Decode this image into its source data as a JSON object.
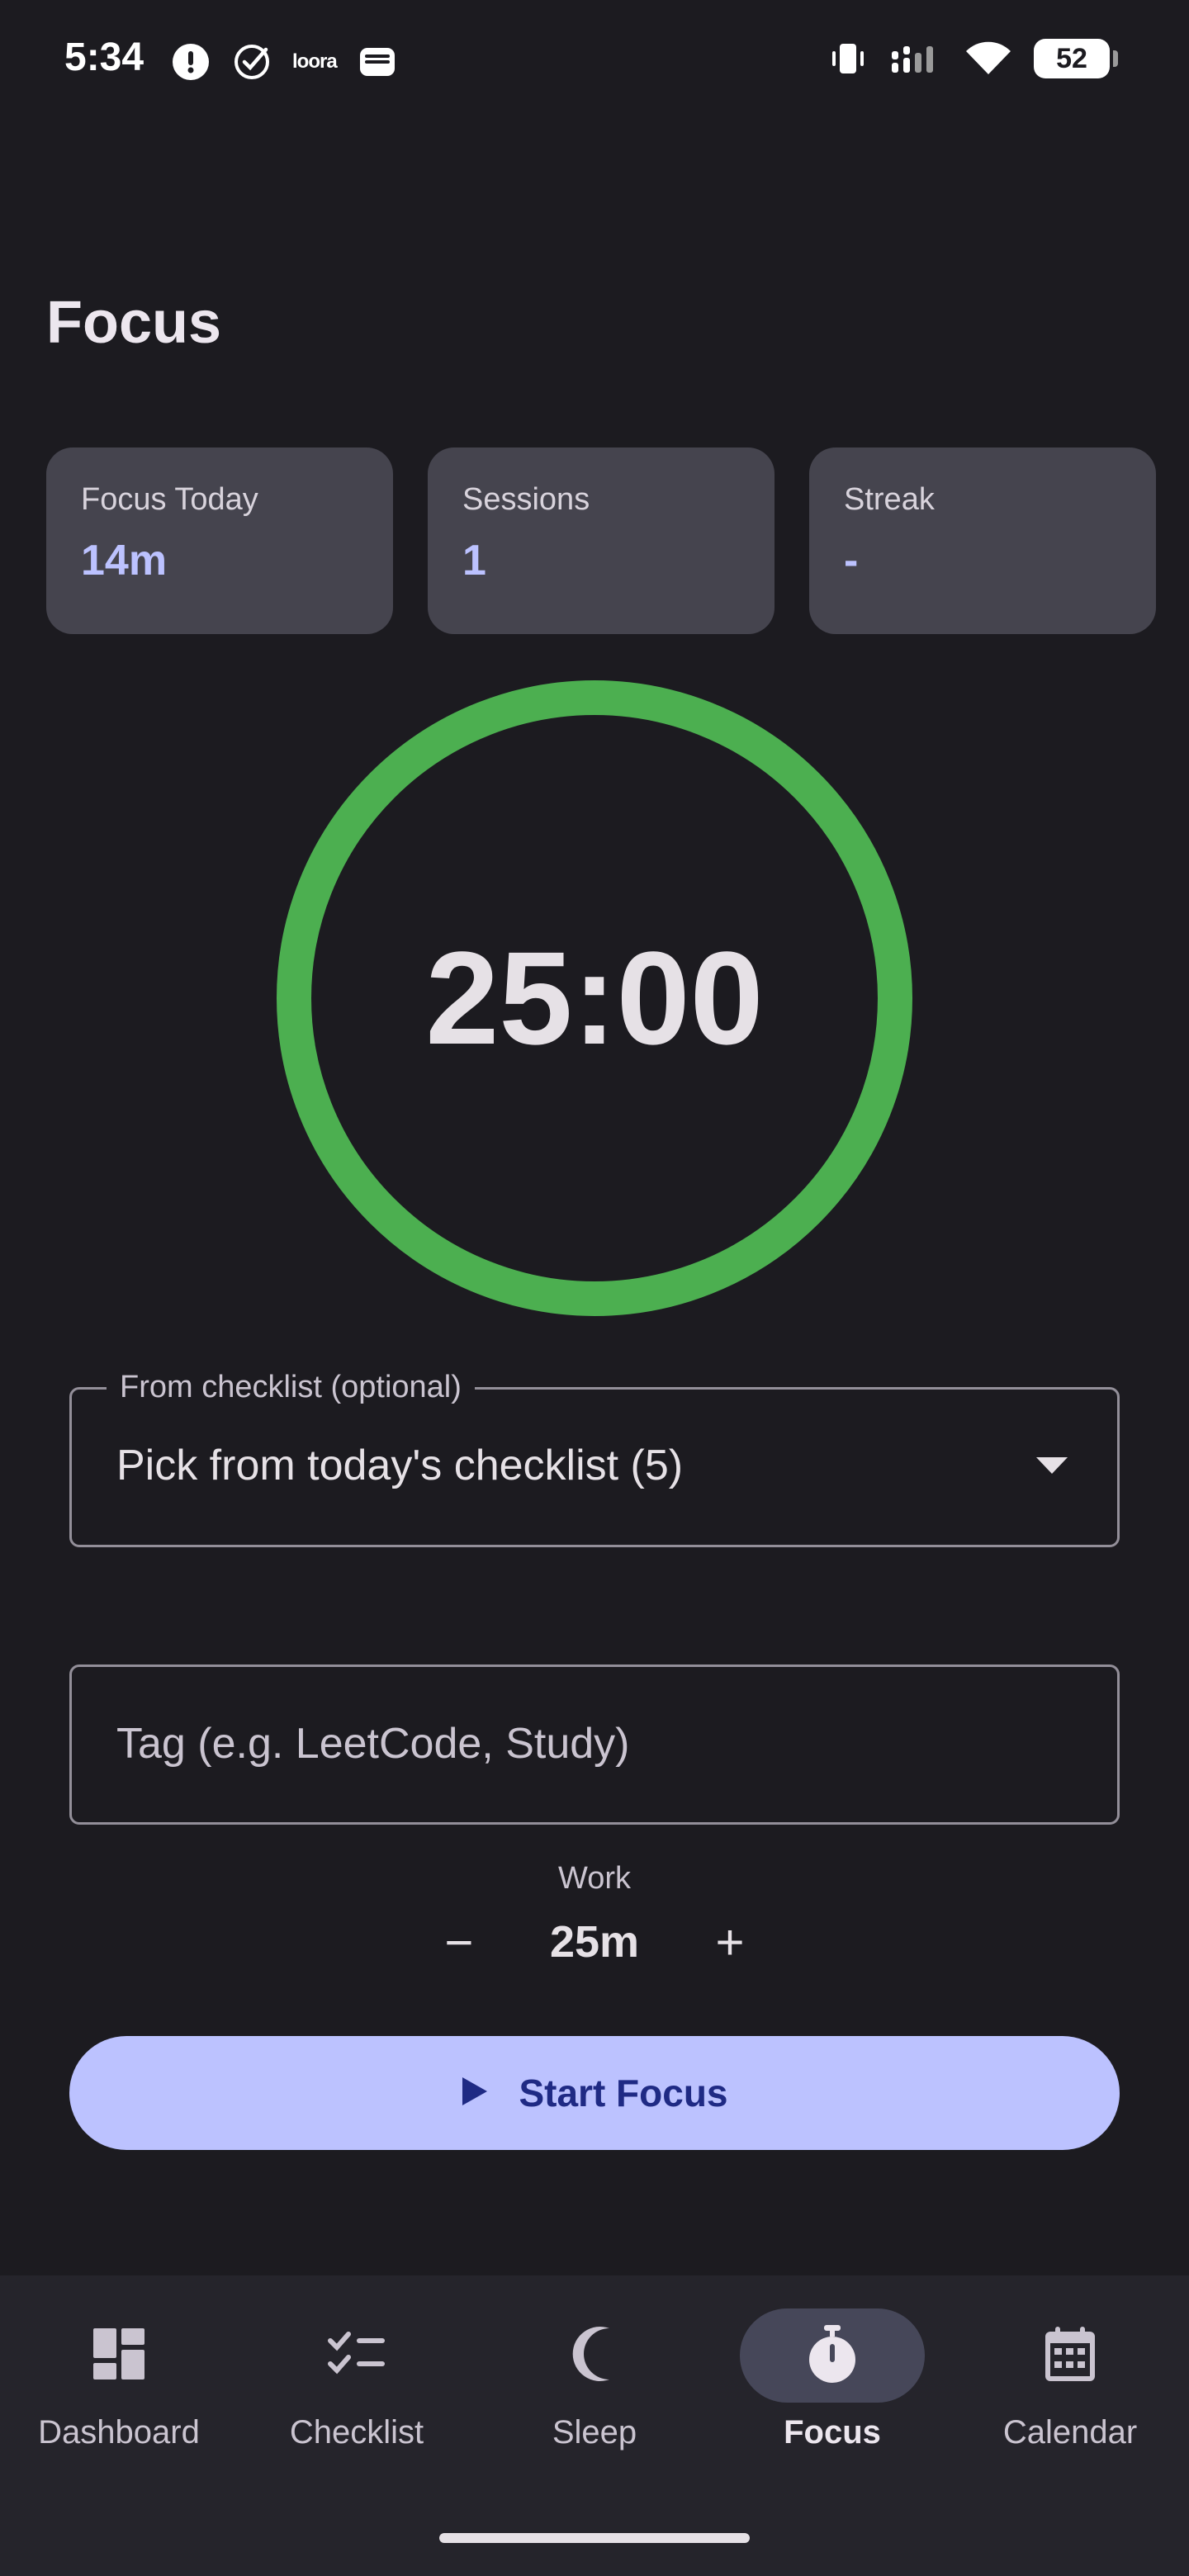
{
  "status_bar": {
    "time": "5:34",
    "left_icons": [
      "alert-icon",
      "check-circle-icon",
      "loora-icon",
      "wallet-icon"
    ],
    "loora_text": "loora",
    "right_icons": [
      "vibrate-icon",
      "signal-icon",
      "wifi-icon",
      "battery-icon"
    ],
    "battery": "52"
  },
  "page": {
    "title": "Focus"
  },
  "stats": [
    {
      "label": "Focus Today",
      "value": "14m"
    },
    {
      "label": "Sessions",
      "value": "1"
    },
    {
      "label": "Streak",
      "value": "-"
    }
  ],
  "timer": {
    "display": "25:00",
    "ring_color": "#4caf50"
  },
  "checklist_picker": {
    "label": "From checklist (optional)",
    "value": "Pick from today's checklist (5)"
  },
  "tag_field": {
    "placeholder": "Tag (e.g. LeetCode, Study)",
    "value": ""
  },
  "work": {
    "label": "Work",
    "value": "25m",
    "decrement_label": "−",
    "increment_label": "+"
  },
  "start_button": {
    "label": "Start Focus"
  },
  "bottom_nav": {
    "items": [
      {
        "label": "Dashboard",
        "icon": "dashboard-icon",
        "active": false
      },
      {
        "label": "Checklist",
        "icon": "checklist-icon",
        "active": false
      },
      {
        "label": "Sleep",
        "icon": "moon-icon",
        "active": false
      },
      {
        "label": "Focus",
        "icon": "timer-icon",
        "active": true
      },
      {
        "label": "Calendar",
        "icon": "calendar-icon",
        "active": false
      }
    ]
  },
  "colors": {
    "background": "#1c1b20",
    "card": "#45444e",
    "accent": "#bcc2ff",
    "accent_on": "#1f2a84",
    "ring": "#4caf50",
    "nav_bg": "#25242b"
  }
}
